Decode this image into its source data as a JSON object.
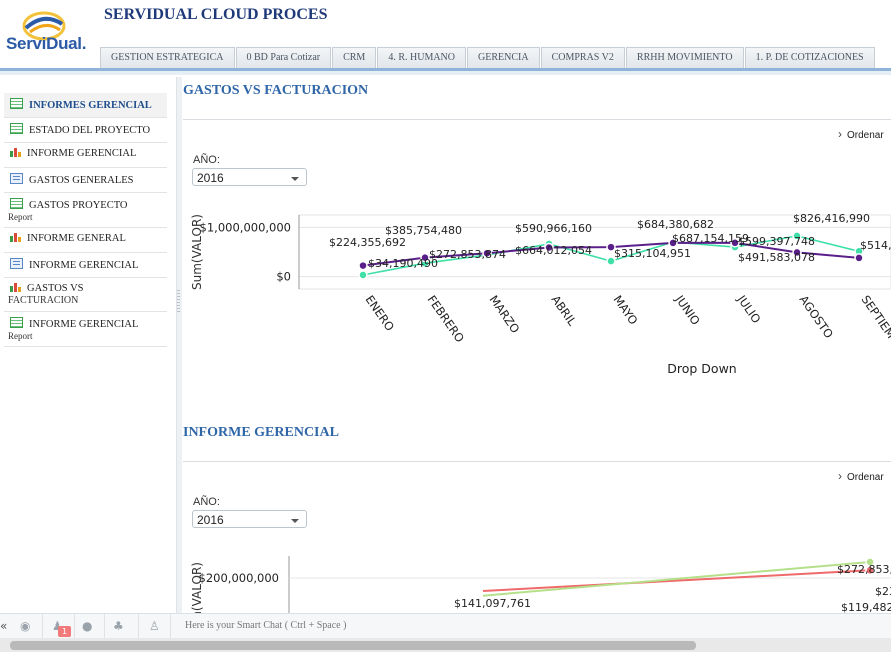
{
  "app": {
    "title": "SERVIDUAL CLOUD PROCES",
    "logo_text": "ServiDual."
  },
  "tabs": [
    {
      "label": "GESTION ESTRATEGICA"
    },
    {
      "label": "0 BD Para Cotizar"
    },
    {
      "label": "CRM"
    },
    {
      "label": "4. R. HUMANO"
    },
    {
      "label": "GERENCIA"
    },
    {
      "label": "COMPRAS V2"
    },
    {
      "label": "RRHH MOVIMIENTO"
    },
    {
      "label": "1. P. DE COTIZACIONES"
    }
  ],
  "sidebar": {
    "items": [
      {
        "label": "INFORMES GERENCIAL",
        "sub": "",
        "icon": "table-icon",
        "active": true
      },
      {
        "label": "ESTADO DEL PROYECTO",
        "sub": "",
        "icon": "table-icon"
      },
      {
        "label": "INFORME GERENCIAL",
        "sub": "",
        "icon": "bar-chart-icon"
      },
      {
        "label": "GASTOS GENERALES",
        "sub": "",
        "icon": "form-icon"
      },
      {
        "label": "GASTOS PROYECTO",
        "sub": "Report",
        "icon": "table-icon"
      },
      {
        "label": "INFORME GENERAL",
        "sub": "",
        "icon": "bar-chart-icon"
      },
      {
        "label": "INFORME GERENCIAL",
        "sub": "",
        "icon": "form-icon"
      },
      {
        "label": "GASTOS VS",
        "sub": "FACTURACION",
        "icon": "bar-chart-icon"
      },
      {
        "label": "INFORME GERENCIAL",
        "sub": "Report",
        "icon": "table-icon"
      }
    ]
  },
  "sections": [
    {
      "title": "GASTOS VS FACTURACION",
      "ordenar": "Ordenar",
      "filter_label": "AÑO:",
      "filter_value": "2016",
      "chart_data": {
        "type": "line",
        "title": "",
        "xlabel": "Drop Down",
        "ylabel": "Sum(VALOR)",
        "yticks": [
          "$1,000,000,000",
          "$0"
        ],
        "ylim": [
          -250000000,
          1250000000
        ],
        "categories": [
          "ENERO",
          "FEBRERO",
          "MARZO",
          "ABRIL",
          "MAYO",
          "JUNIO",
          "JULIO",
          "AGOSTO",
          "SEPTIEM"
        ],
        "series": [
          {
            "color": "#5a1e8a",
            "values": [
              224355692,
              385754480,
              475000000,
              590966160,
              600000000,
              684380682,
              687154159,
              491583078,
              380000000
            ]
          },
          {
            "color": "#3ee0a8",
            "values": [
              34190490,
              272853874,
              440000000,
              664012054,
              315104951,
              700000000,
              599397748,
              826416990,
              514000000
            ]
          }
        ],
        "labels": [
          {
            "text": "$224,355,692"
          },
          {
            "text": "$34,190,490"
          },
          {
            "text": "$385,754,480"
          },
          {
            "text": "$272,853,874"
          },
          {
            "text": "$590,966,160"
          },
          {
            "text": "$664,012,054"
          },
          {
            "text": "$315,104,951"
          },
          {
            "text": "$684,380,682"
          },
          {
            "text": "$687,154,159"
          },
          {
            "text": "$599,397,748"
          },
          {
            "text": "$826,416,990"
          },
          {
            "text": "$491,583,078"
          },
          {
            "text": "$514,0"
          }
        ]
      }
    },
    {
      "title": "INFORME GERENCIAL",
      "ordenar": "Ordenar",
      "filter_label": "AÑO:",
      "filter_value": "2016",
      "chart_data": {
        "type": "line",
        "title": "",
        "ylabel": "Sum(VALOR)",
        "yticks": [
          "$200,000,000"
        ],
        "ylim": [
          0,
          300000000
        ],
        "series": [
          {
            "color": "#ef6a6a",
            "values": [
              141097761,
              235000000
            ]
          },
          {
            "color": "#b5e08a",
            "values": [
              119482170,
              272853874
            ]
          }
        ],
        "labels": [
          {
            "text": "$141,097,761"
          },
          {
            "text": "$272,853,8"
          },
          {
            "text": "$23"
          },
          {
            "text": "$119,482,17"
          }
        ]
      }
    }
  ],
  "chat": {
    "placeholder": "Here is your Smart Chat ( Ctrl + Space )",
    "badge": "1"
  },
  "colors": {
    "title": "#1f3a7a",
    "section_title": "#2f66a8",
    "accent_bar": "#8fb3d9"
  }
}
